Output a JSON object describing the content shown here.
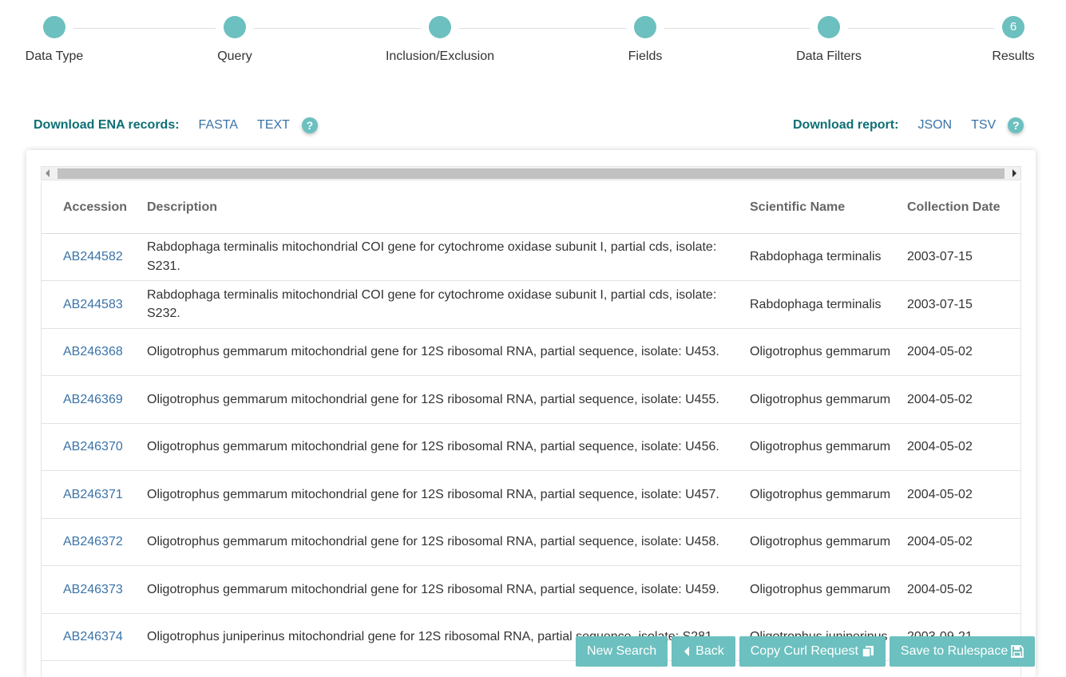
{
  "stepper": {
    "steps": [
      {
        "label": "Data Type",
        "number": ""
      },
      {
        "label": "Query",
        "number": ""
      },
      {
        "label": "Inclusion/Exclusion",
        "number": ""
      },
      {
        "label": "Fields",
        "number": ""
      },
      {
        "label": "Data Filters",
        "number": ""
      },
      {
        "label": "Results",
        "number": "6"
      }
    ],
    "color": "#6cc0bf"
  },
  "download_records": {
    "title": "Download ENA records:",
    "formats": [
      "FASTA",
      "TEXT"
    ],
    "help": "?"
  },
  "download_report": {
    "title": "Download report:",
    "formats": [
      "JSON",
      "TSV"
    ],
    "help": "?"
  },
  "table": {
    "columns": [
      "Accession",
      "Description",
      "Scientific Name",
      "Collection Date"
    ],
    "rows": [
      [
        "AB244582",
        "Rabdophaga terminalis mitochondrial COI gene for cytochrome oxidase subunit I, partial cds, isolate: S231.",
        "Rabdophaga terminalis",
        "2003-07-15"
      ],
      [
        "AB244583",
        "Rabdophaga terminalis mitochondrial COI gene for cytochrome oxidase subunit I, partial cds, isolate: S232.",
        "Rabdophaga terminalis",
        "2003-07-15"
      ],
      [
        "AB246368",
        "Oligotrophus gemmarum mitochondrial gene for 12S ribosomal RNA, partial sequence, isolate: U453.",
        "Oligotrophus gemmarum",
        "2004-05-02"
      ],
      [
        "AB246369",
        "Oligotrophus gemmarum mitochondrial gene for 12S ribosomal RNA, partial sequence, isolate: U455.",
        "Oligotrophus gemmarum",
        "2004-05-02"
      ],
      [
        "AB246370",
        "Oligotrophus gemmarum mitochondrial gene for 12S ribosomal RNA, partial sequence, isolate: U456.",
        "Oligotrophus gemmarum",
        "2004-05-02"
      ],
      [
        "AB246371",
        "Oligotrophus gemmarum mitochondrial gene for 12S ribosomal RNA, partial sequence, isolate: U457.",
        "Oligotrophus gemmarum",
        "2004-05-02"
      ],
      [
        "AB246372",
        "Oligotrophus gemmarum mitochondrial gene for 12S ribosomal RNA, partial sequence, isolate: U458.",
        "Oligotrophus gemmarum",
        "2004-05-02"
      ],
      [
        "AB246373",
        "Oligotrophus gemmarum mitochondrial gene for 12S ribosomal RNA, partial sequence, isolate: U459.",
        "Oligotrophus gemmarum",
        "2004-05-02"
      ],
      [
        "AB246374",
        "Oligotrophus juniperinus mitochondrial gene for 12S ribosomal RNA, partial sequence, isolate: S281.",
        "Oligotrophus juniperinus",
        "2003-09-21"
      ]
    ]
  },
  "actions": {
    "new_search": "New Search",
    "back": "Back",
    "copy_curl": "Copy Curl Request",
    "save_rulespace": "Save to Rulespace"
  },
  "colors": {
    "accent": "#6cc0bf",
    "title": "#0e6f74",
    "link": "#3a73a8"
  }
}
